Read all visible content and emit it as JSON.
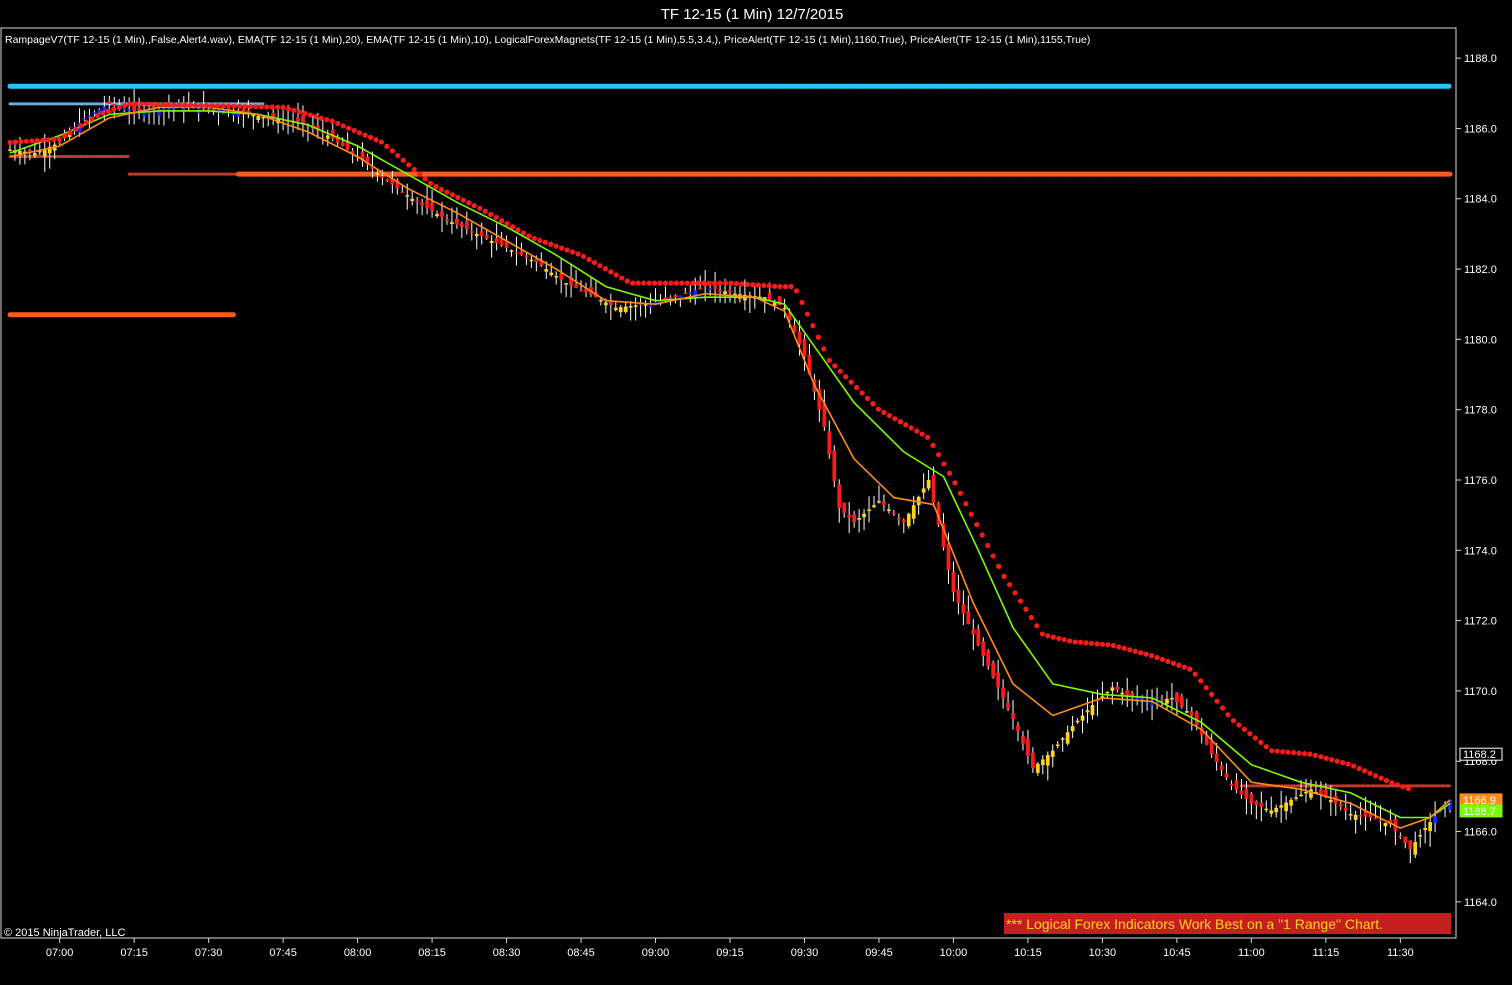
{
  "window": {
    "title": "TF 12-15 (1 Min)  12/7/2015"
  },
  "indicator_label": "RampageV7(TF 12-15 (1 Min),,False,Alert4.wav), EMA(TF 12-15 (1 Min),20), EMA(TF 12-15 (1 Min),10), LogicalForexMagnets(TF 12-15 (1 Min),5.5,3.4,), PriceAlert(TF 12-15 (1 Min),1160,True), PriceAlert(TF 12-15 (1 Min),1155,True)",
  "copyright": "© 2015 NinjaTrader, LLC",
  "banner": "*** Logical Forex Indicators Work Best on a \"1 Range\" Chart.",
  "colors": {
    "background": "#000000",
    "up_bar": "#ffd21e",
    "down_bar": "#ff1a1a",
    "blue_bar": "#1428ff",
    "ema20": "#7cfc00",
    "ema10": "#ff8c1a",
    "trail_dots": "#ff1a1a",
    "magnet_cyan": "#1ec8ff",
    "magnet_orange": "#ff5a1e",
    "alert_dash": "#ff3030",
    "banner_bg": "#c41e1e"
  },
  "chart_data": {
    "type": "candlestick",
    "title": "TF 12-15 (1 Min)  12/7/2015",
    "ylim": [
      1163.0,
      1188.8
    ],
    "y_ticks": [
      "1164.0",
      "1166.0",
      "1168.0",
      "1170.0",
      "1172.0",
      "1174.0",
      "1176.0",
      "1178.0",
      "1180.0",
      "1182.0",
      "1184.0",
      "1186.0",
      "1188.0"
    ],
    "x_ticks": [
      "07:00",
      "07:15",
      "07:30",
      "07:45",
      "08:00",
      "08:15",
      "08:30",
      "08:45",
      "09:00",
      "09:15",
      "09:30",
      "09:45",
      "10:00",
      "10:15",
      "10:30",
      "10:45",
      "11:00",
      "11:15",
      "11:30"
    ],
    "x_range_minutes": [
      -10,
      280
    ],
    "price_path": [
      [
        -10,
        1185.4
      ],
      [
        -5,
        1185.3
      ],
      [
        0,
        1185.6
      ],
      [
        5,
        1186.3
      ],
      [
        10,
        1186.7
      ],
      [
        15,
        1186.5
      ],
      [
        25,
        1186.6
      ],
      [
        35,
        1186.5
      ],
      [
        42,
        1186.3
      ],
      [
        48,
        1186.2
      ],
      [
        54,
        1185.8
      ],
      [
        60,
        1185.2
      ],
      [
        66,
        1184.5
      ],
      [
        72,
        1183.9
      ],
      [
        78,
        1183.4
      ],
      [
        84,
        1183.0
      ],
      [
        90,
        1182.6
      ],
      [
        96,
        1182.2
      ],
      [
        102,
        1181.6
      ],
      [
        108,
        1181.2
      ],
      [
        112,
        1180.9
      ],
      [
        118,
        1181.0
      ],
      [
        124,
        1181.2
      ],
      [
        130,
        1181.5
      ],
      [
        136,
        1181.3
      ],
      [
        142,
        1181.2
      ],
      [
        146,
        1180.9
      ],
      [
        150,
        1179.5
      ],
      [
        154,
        1177.5
      ],
      [
        157,
        1175.2
      ],
      [
        160,
        1174.8
      ],
      [
        165,
        1175.4
      ],
      [
        170,
        1174.8
      ],
      [
        175,
        1176.0
      ],
      [
        180,
        1172.8
      ],
      [
        184,
        1171.6
      ],
      [
        188,
        1170.4
      ],
      [
        192,
        1169.2
      ],
      [
        196,
        1167.8
      ],
      [
        200,
        1168.3
      ],
      [
        204,
        1169.0
      ],
      [
        208,
        1169.6
      ],
      [
        212,
        1170.1
      ],
      [
        216,
        1169.8
      ],
      [
        220,
        1169.7
      ],
      [
        224,
        1169.8
      ],
      [
        228,
        1169.3
      ],
      [
        232,
        1168.2
      ],
      [
        236,
        1167.3
      ],
      [
        240,
        1166.8
      ],
      [
        244,
        1166.6
      ],
      [
        248,
        1166.9
      ],
      [
        252,
        1167.2
      ],
      [
        256,
        1166.9
      ],
      [
        260,
        1166.5
      ],
      [
        264,
        1166.4
      ],
      [
        268,
        1166.2
      ],
      [
        272,
        1165.5
      ],
      [
        275,
        1166.1
      ],
      [
        278,
        1166.6
      ],
      [
        280,
        1166.9
      ]
    ],
    "ema20": [
      [
        -10,
        1185.3
      ],
      [
        0,
        1185.8
      ],
      [
        10,
        1186.4
      ],
      [
        20,
        1186.5
      ],
      [
        30,
        1186.5
      ],
      [
        40,
        1186.4
      ],
      [
        50,
        1186.1
      ],
      [
        60,
        1185.5
      ],
      [
        70,
        1184.7
      ],
      [
        80,
        1183.9
      ],
      [
        90,
        1183.2
      ],
      [
        100,
        1182.4
      ],
      [
        110,
        1181.5
      ],
      [
        120,
        1181.1
      ],
      [
        130,
        1181.2
      ],
      [
        140,
        1181.2
      ],
      [
        146,
        1181.0
      ],
      [
        152,
        1179.8
      ],
      [
        160,
        1178.2
      ],
      [
        170,
        1176.8
      ],
      [
        178,
        1176.1
      ],
      [
        185,
        1174.0
      ],
      [
        192,
        1171.8
      ],
      [
        200,
        1170.2
      ],
      [
        210,
        1169.9
      ],
      [
        220,
        1169.8
      ],
      [
        230,
        1169.1
      ],
      [
        240,
        1167.9
      ],
      [
        250,
        1167.4
      ],
      [
        260,
        1167.1
      ],
      [
        270,
        1166.4
      ],
      [
        276,
        1166.4
      ],
      [
        280,
        1166.8
      ]
    ],
    "ema10": [
      [
        -10,
        1185.2
      ],
      [
        0,
        1185.5
      ],
      [
        10,
        1186.3
      ],
      [
        20,
        1186.6
      ],
      [
        30,
        1186.6
      ],
      [
        40,
        1186.4
      ],
      [
        50,
        1185.9
      ],
      [
        60,
        1185.2
      ],
      [
        70,
        1184.3
      ],
      [
        80,
        1183.6
      ],
      [
        90,
        1182.8
      ],
      [
        100,
        1182.0
      ],
      [
        110,
        1181.1
      ],
      [
        120,
        1181.0
      ],
      [
        130,
        1181.3
      ],
      [
        140,
        1181.2
      ],
      [
        146,
        1180.8
      ],
      [
        152,
        1178.7
      ],
      [
        160,
        1176.6
      ],
      [
        168,
        1175.5
      ],
      [
        176,
        1175.3
      ],
      [
        184,
        1172.5
      ],
      [
        192,
        1170.2
      ],
      [
        200,
        1169.3
      ],
      [
        210,
        1169.8
      ],
      [
        220,
        1169.7
      ],
      [
        230,
        1168.9
      ],
      [
        240,
        1167.4
      ],
      [
        250,
        1167.2
      ],
      [
        260,
        1166.8
      ],
      [
        270,
        1166.1
      ],
      [
        276,
        1166.4
      ],
      [
        280,
        1166.9
      ]
    ],
    "trail_stop_dots": [
      [
        -10,
        1185.6
      ],
      [
        0,
        1185.7
      ],
      [
        8,
        1186.4
      ],
      [
        14,
        1186.7
      ],
      [
        45,
        1186.6
      ],
      [
        55,
        1186.2
      ],
      [
        65,
        1185.6
      ],
      [
        75,
        1184.4
      ],
      [
        85,
        1183.7
      ],
      [
        95,
        1182.9
      ],
      [
        105,
        1182.4
      ],
      [
        115,
        1181.6
      ],
      [
        125,
        1181.6
      ],
      [
        135,
        1181.6
      ],
      [
        145,
        1181.5
      ],
      [
        148,
        1181.5
      ],
      [
        155,
        1179.4
      ],
      [
        165,
        1178.0
      ],
      [
        175,
        1177.2
      ],
      [
        180,
        1176.0
      ],
      [
        190,
        1173.3
      ],
      [
        198,
        1171.6
      ],
      [
        204,
        1171.4
      ],
      [
        212,
        1171.3
      ],
      [
        220,
        1171.0
      ],
      [
        228,
        1170.6
      ],
      [
        236,
        1169.2
      ],
      [
        244,
        1168.3
      ],
      [
        252,
        1168.2
      ],
      [
        260,
        1167.9
      ],
      [
        268,
        1167.4
      ],
      [
        272,
        1167.2
      ]
    ],
    "magnet_levels": [
      {
        "name": "cyan",
        "price": 1187.2,
        "from_min": -10,
        "to_min": 280
      },
      {
        "name": "light-blue dash",
        "price": 1186.7,
        "from_min": -10,
        "to_min": 41
      },
      {
        "name": "dark-red dash",
        "price": 1185.2,
        "from_min": -10,
        "to_min": 14
      },
      {
        "name": "dark-red dash",
        "price": 1184.7,
        "from_min": 14,
        "to_min": 36
      },
      {
        "name": "orange-red",
        "price": 1184.7,
        "from_min": 36,
        "to_min": 280
      },
      {
        "name": "orange-red",
        "price": 1180.7,
        "from_min": -10,
        "to_min": 35
      },
      {
        "name": "dark-red dash",
        "price": 1167.3,
        "from_min": 238,
        "to_min": 280
      }
    ],
    "last_prices": [
      {
        "label": "1168.2",
        "price": 1168.2,
        "color": "#ffffff"
      },
      {
        "label": "1166.9",
        "price": 1166.9,
        "color": "#ff8c1a"
      },
      {
        "label": "1166.7",
        "price": 1166.7,
        "color": "#7cfc00"
      }
    ]
  }
}
